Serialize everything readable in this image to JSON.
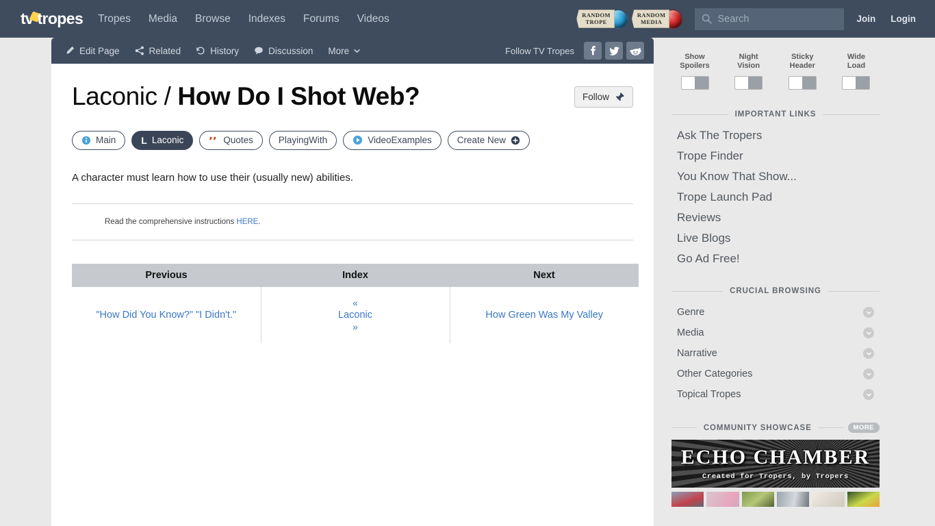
{
  "topnav": {
    "logo_text_a": "tv",
    "logo_text_b": "tropes",
    "links": [
      {
        "label": "Tropes"
      },
      {
        "label": "Media"
      },
      {
        "label": "Browse"
      },
      {
        "label": "Indexes"
      },
      {
        "label": "Forums"
      },
      {
        "label": "Videos"
      }
    ],
    "random_trope": {
      "line1": "RANDOM",
      "line2": "TROPE"
    },
    "random_media": {
      "line1": "RANDOM",
      "line2": "MEDIA"
    },
    "search": {
      "value": "",
      "placeholder": "Search"
    },
    "join_label": "Join",
    "login_label": "Login"
  },
  "actionbar": {
    "items": [
      {
        "label": "Edit Page",
        "icon": "pencil-icon"
      },
      {
        "label": "Related",
        "icon": "share-icon"
      },
      {
        "label": "History",
        "icon": "history-icon"
      },
      {
        "label": "Discussion",
        "icon": "comment-icon"
      },
      {
        "label": "More",
        "icon": "chevron-down-icon"
      }
    ],
    "follow_label": "Follow TV Tropes",
    "social": [
      {
        "name": "facebook-icon"
      },
      {
        "name": "twitter-icon"
      },
      {
        "name": "reddit-icon"
      }
    ]
  },
  "main": {
    "title_light": "Laconic /",
    "title_bold": "How Do I Shot Web?",
    "follow_button": "Follow",
    "tabs": [
      {
        "label": "Main",
        "icon": "info-circle-icon",
        "active": false
      },
      {
        "label": "Laconic",
        "icon": "laconic-l-icon",
        "active": true
      },
      {
        "label": "Quotes",
        "icon": "quote-icon",
        "active": false
      },
      {
        "label": "PlayingWith",
        "icon": "none",
        "active": false
      },
      {
        "label": "VideoExamples",
        "icon": "play-circle-icon",
        "active": false
      },
      {
        "label": "Create New",
        "icon": "plus-circle-icon",
        "active": false
      }
    ],
    "laconic_text": "A character must learn how to use their (usually new) abilities.",
    "instructions_prefix": "Read the comprehensive instructions ",
    "instructions_link": "HERE",
    "instructions_suffix": ".",
    "nav_table": {
      "headers": [
        "Previous",
        "Index",
        "Next"
      ],
      "previous": "\"How Did You Know?\" \"I Didn't.\"",
      "index_up": "«",
      "index": "Laconic",
      "index_down": "»",
      "next": "How Green Was My Valley"
    }
  },
  "sidebar": {
    "toggles": [
      {
        "line1": "Show",
        "line2": "Spoilers",
        "on": false
      },
      {
        "line1": "Night",
        "line2": "Vision",
        "on": false
      },
      {
        "line1": "Sticky",
        "line2": "Header",
        "on": false
      },
      {
        "line1": "Wide",
        "line2": "Load",
        "on": false
      }
    ],
    "important_links": {
      "title": "IMPORTANT LINKS",
      "items": [
        {
          "label": "Ask The Tropers"
        },
        {
          "label": "Trope Finder"
        },
        {
          "label": "You Know That Show..."
        },
        {
          "label": "Trope Launch Pad"
        },
        {
          "label": "Reviews"
        },
        {
          "label": "Live Blogs"
        },
        {
          "label": "Go Ad Free!"
        }
      ]
    },
    "crucial_browsing": {
      "title": "CRUCIAL BROWSING",
      "items": [
        {
          "label": "Genre"
        },
        {
          "label": "Media"
        },
        {
          "label": "Narrative"
        },
        {
          "label": "Other Categories"
        },
        {
          "label": "Topical Tropes"
        }
      ]
    },
    "community_showcase": {
      "title": "COMMUNITY SHOWCASE",
      "more_label": "MORE",
      "banner_title": "ECHO CHAMBER",
      "banner_subtitle": "Created for Tropers, by Tropers"
    }
  },
  "colors": {
    "header_bg": "#3e4c5e",
    "page_bg": "#e9e9e9",
    "link_blue": "#3b77c4",
    "table_header": "#c6cace",
    "accent_yellow": "#ffd24a"
  }
}
